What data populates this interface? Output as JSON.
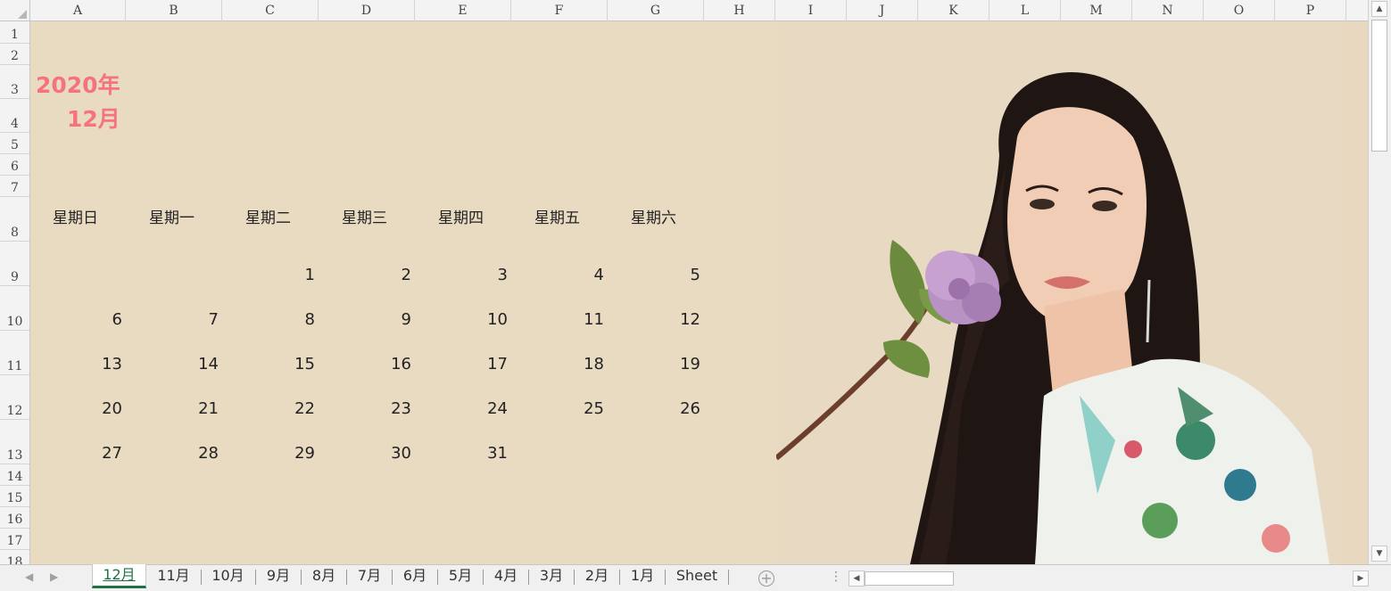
{
  "columns": [
    "A",
    "B",
    "C",
    "D",
    "E",
    "F",
    "G",
    "H",
    "I",
    "J",
    "K",
    "L",
    "M",
    "N",
    "O",
    "P"
  ],
  "rows": [
    "1",
    "2",
    "3",
    "4",
    "5",
    "6",
    "7",
    "8",
    "9",
    "10",
    "11",
    "12",
    "13",
    "14",
    "15",
    "16",
    "17",
    "18"
  ],
  "calendar": {
    "year": "2020年",
    "month": "12月",
    "weekdays": [
      "星期日",
      "星期一",
      "星期二",
      "星期三",
      "星期四",
      "星期五",
      "星期六"
    ],
    "weeks": [
      [
        "",
        "",
        "1",
        "2",
        "3",
        "4",
        "5"
      ],
      [
        "6",
        "7",
        "8",
        "9",
        "10",
        "11",
        "12"
      ],
      [
        "13",
        "14",
        "15",
        "16",
        "17",
        "18",
        "19"
      ],
      [
        "20",
        "21",
        "22",
        "23",
        "24",
        "25",
        "26"
      ],
      [
        "27",
        "28",
        "29",
        "30",
        "31",
        "",
        ""
      ]
    ]
  },
  "sheet_tabs": [
    "12月",
    "11月",
    "10月",
    "9月",
    "8月",
    "7月",
    "6月",
    "5月",
    "4月",
    "3月",
    "2月",
    "1月",
    "Sheet"
  ],
  "active_tab": "12月",
  "colors": {
    "title": "#f5737d",
    "background": "#e9dbc2",
    "active_tab": "#1e7145"
  },
  "icons": {
    "add_sheet": "plus-circle-icon",
    "scroll_up": "triangle-up-icon",
    "scroll_down": "triangle-down-icon",
    "scroll_left": "triangle-left-icon",
    "scroll_right": "triangle-right-icon"
  }
}
